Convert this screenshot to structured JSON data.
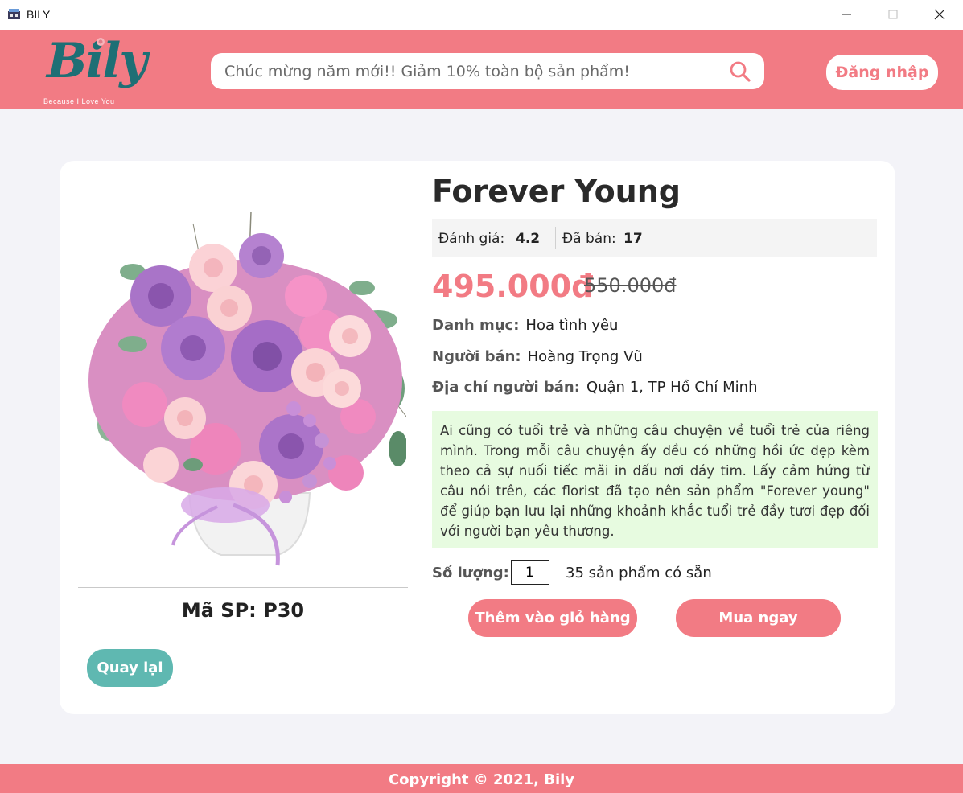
{
  "window": {
    "title": "BILY"
  },
  "header": {
    "logo_text": "Bily",
    "logo_tagline": "Because I Love You",
    "search_placeholder": "Chúc mừng năm mới!! Giảm 10% toàn bộ sản phẩm!",
    "login_label": "Đăng nhập"
  },
  "product": {
    "name": "Forever Young",
    "rating_label": "Đánh giá:",
    "rating_value": "4.2",
    "sold_label": "Đã bán:",
    "sold_value": "17",
    "price": "495.000đ",
    "old_price": "550.000đ",
    "category_label": "Danh mục:",
    "category_value": "Hoa tình yêu",
    "seller_label": "Người bán:",
    "seller_value": "Hoàng Trọng Vũ",
    "address_label": "Địa chỉ người bán:",
    "address_value": "Quận 1, TP Hồ Chí Minh",
    "description": "Ai cũng có tuổi trẻ và những câu chuyện về tuổi trẻ của riêng mình. Trong mỗi câu chuyện ấy đều có những hồi ức đẹp kèm theo cả sự nuối tiếc mãi in dấu nơi đáy tim. Lấy cảm hứng từ câu nói trên, các florist đã tạo nên sản phẩm \"Forever young\" để giúp bạn lưu lại những khoảnh khắc tuổi trẻ đầy tươi đẹp đối với người bạn yêu thương.",
    "quantity_label": "Số lượng:",
    "quantity_value": "1",
    "stock_text": "35  sản phẩm có sẵn",
    "sku": "Mã SP: P30"
  },
  "actions": {
    "add_to_cart": "Thêm vào giỏ hàng",
    "buy_now": "Mua ngay",
    "back": "Quay lại"
  },
  "footer": {
    "copyright": "Copyright © 2021, Bily"
  },
  "colors": {
    "brand_pink": "#f27b84",
    "logo_teal": "#1e6f75",
    "back_teal": "#5fb8b1",
    "desc_bg": "#e7fbe0",
    "page_bg": "#f3f3f8"
  },
  "icons": {
    "app": "flower-shop-icon",
    "search": "search-icon",
    "minimize": "minimize-icon",
    "maximize": "maximize-icon",
    "close": "close-icon"
  }
}
